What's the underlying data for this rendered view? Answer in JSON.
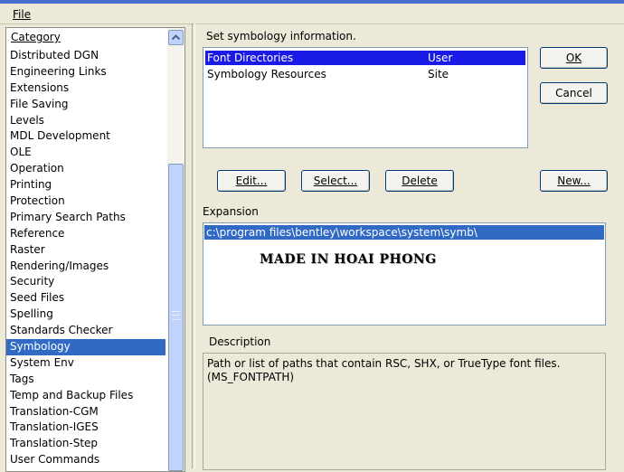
{
  "menu": {
    "file_label": "File"
  },
  "category": {
    "header": "Category",
    "items": [
      "Distributed DGN",
      "Engineering Links",
      "Extensions",
      "File Saving",
      "Levels",
      "MDL Development",
      "OLE",
      "Operation",
      "Printing",
      "Protection",
      "Primary Search Paths",
      "Reference",
      "Raster",
      "Rendering/Images",
      "Security",
      "Seed Files",
      "Spelling",
      "Standards Checker",
      "Symbology",
      "System Env",
      "Tags",
      "Temp and Backup Files",
      "Translation-CGM",
      "Translation-IGES",
      "Translation-Step",
      "User Commands"
    ],
    "selected": "Symbology"
  },
  "symbology": {
    "instruction": "Set symbology information.",
    "rows": [
      {
        "name": "Font Directories",
        "level": "User",
        "selected": true
      },
      {
        "name": "Symbology Resources",
        "level": "Site",
        "selected": false
      }
    ]
  },
  "buttons": {
    "ok": "OK",
    "cancel": "Cancel",
    "edit": "Edit...",
    "select": "Select...",
    "delete": "Delete",
    "new": "New..."
  },
  "expansion": {
    "label": "Expansion",
    "value": "c:\\program files\\bentley\\workspace\\system\\symb\\",
    "watermark": "MADE IN HOAI PHONG"
  },
  "description": {
    "label": "Description",
    "line1": "Path or list of paths that contain RSC, SHX, or TrueType font files.",
    "line2": "(MS_FONTPATH)"
  },
  "colors": {
    "selection": "#316ac5",
    "list_selection": "#1a1ae6",
    "face": "#ece9d8"
  }
}
